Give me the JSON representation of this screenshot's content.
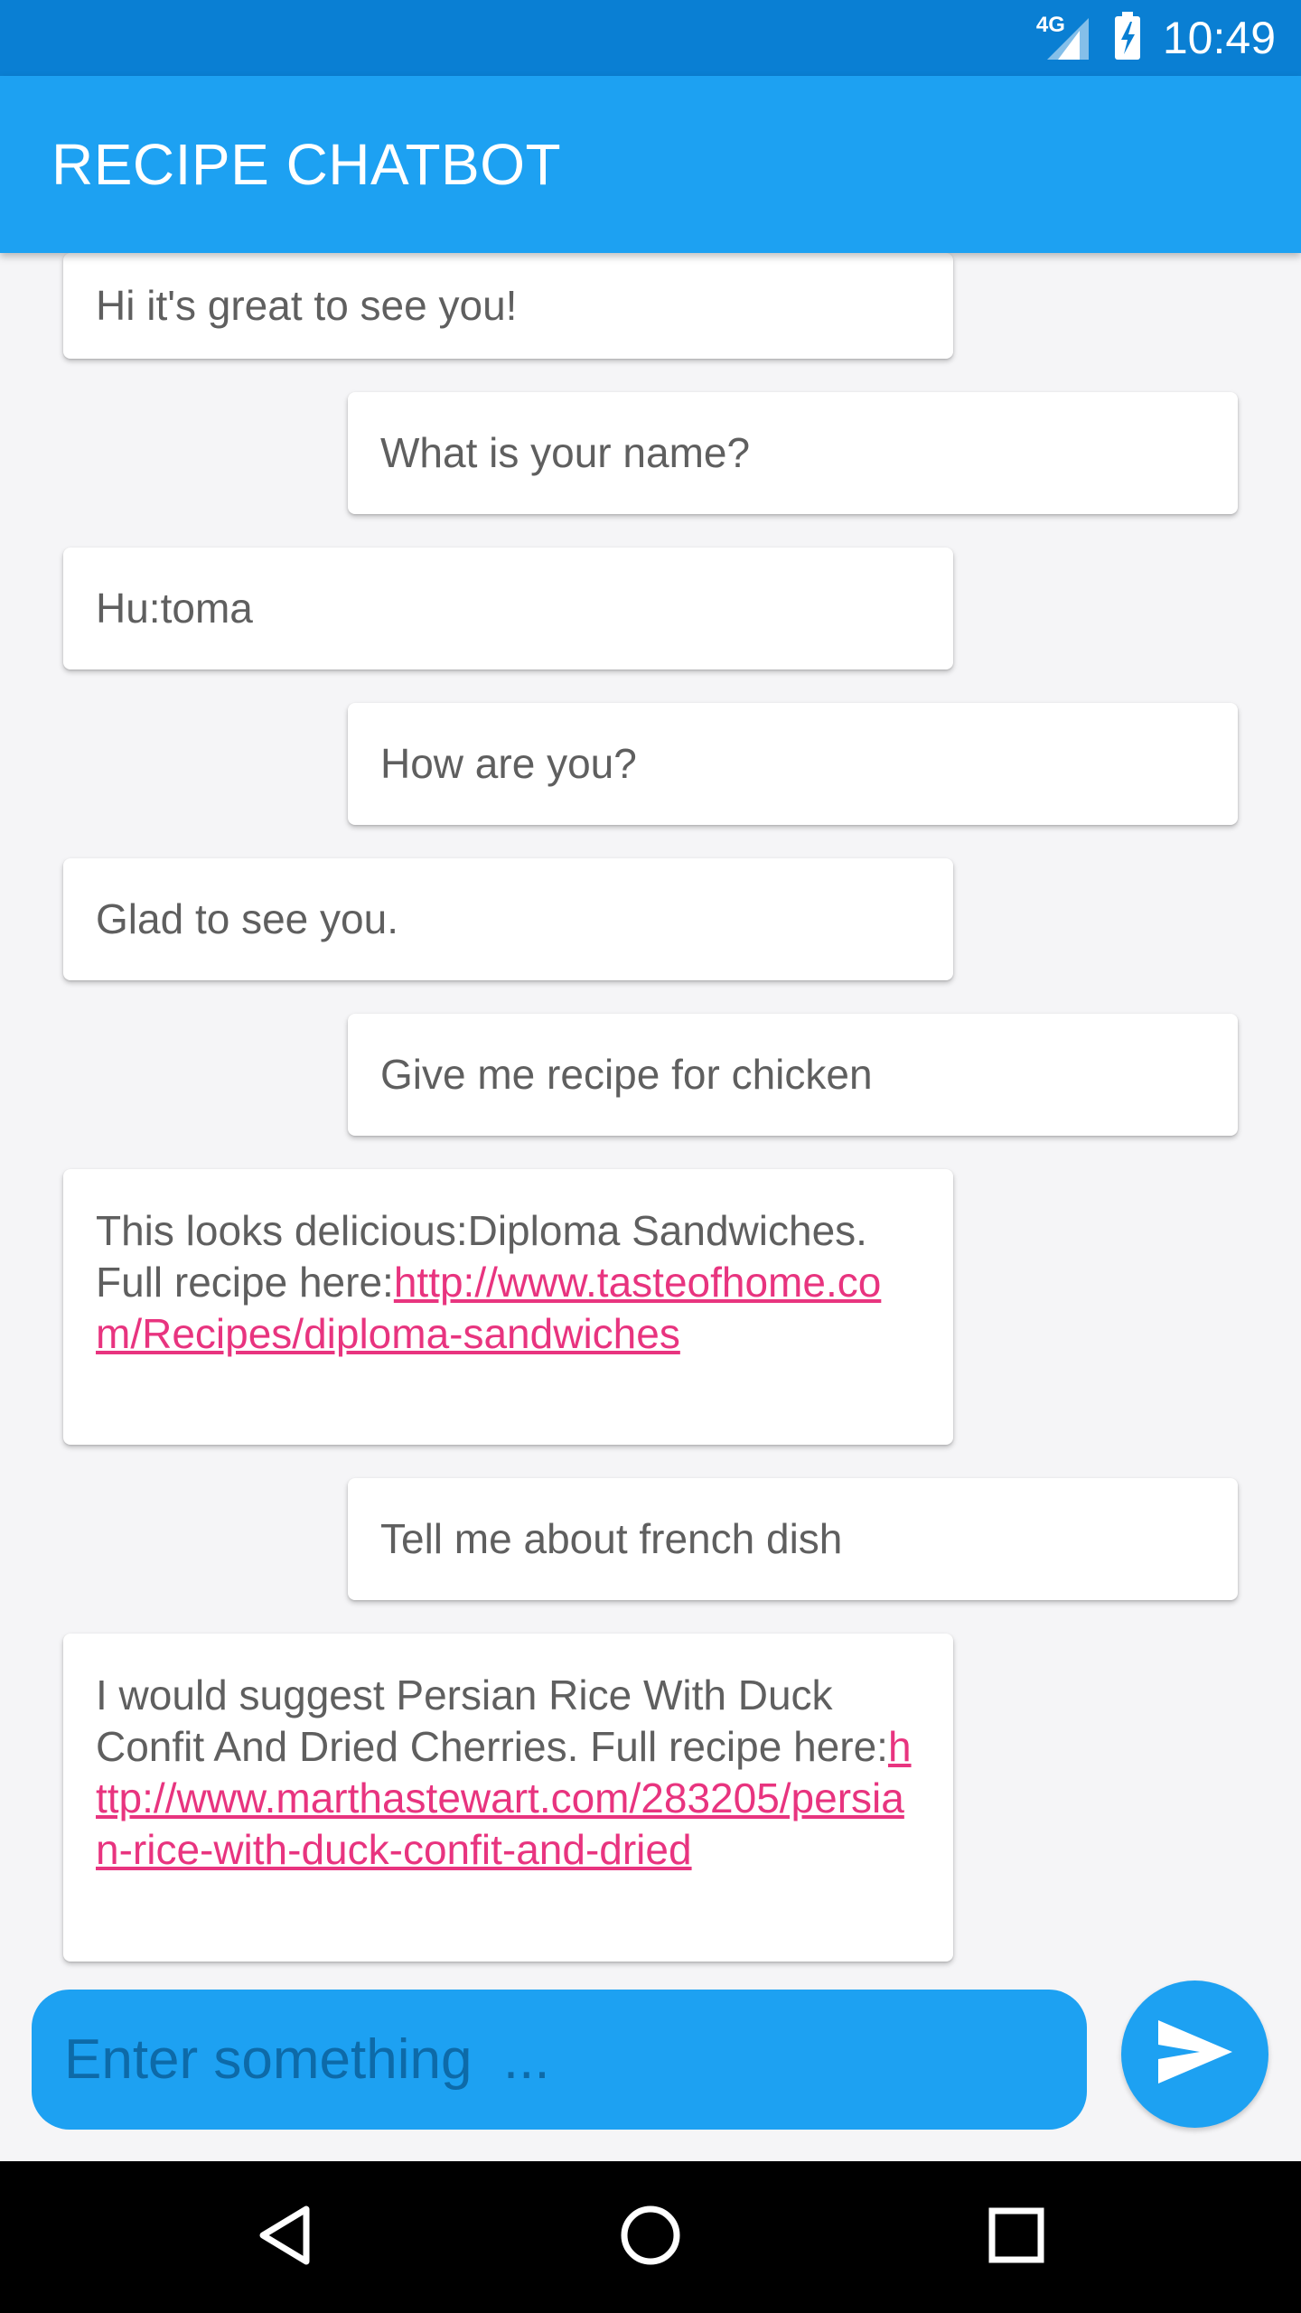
{
  "status_bar": {
    "network": "4G",
    "time": "10:49",
    "icons": [
      "signal-icon",
      "battery-charging-icon"
    ]
  },
  "app_bar": {
    "title": "RECIPE CHATBOT"
  },
  "messages": [
    {
      "sender": "bot",
      "text": "Hi it's great to see you!"
    },
    {
      "sender": "user",
      "text": "What is your name?"
    },
    {
      "sender": "bot",
      "text": "Hu:toma"
    },
    {
      "sender": "user",
      "text": "How are you?"
    },
    {
      "sender": "bot",
      "text": "Glad to see you."
    },
    {
      "sender": "user",
      "text": "Give me recipe for chicken"
    },
    {
      "sender": "bot",
      "text": "This looks delicious:Diploma Sandwiches. Full recipe here:",
      "link": "http://www.tasteofhome.com/Recipes/diploma-sandwiches"
    },
    {
      "sender": "user",
      "text": "Tell me about french dish"
    },
    {
      "sender": "bot",
      "text": "I would suggest Persian Rice With Duck Confit And Dried Cherries. Full recipe here:",
      "link": "http://www.marthastewart.com/283205/persian-rice-with-duck-confit-and-dried"
    }
  ],
  "composer": {
    "placeholder": "Enter something  ...",
    "send_icon": "send-icon"
  },
  "nav": {
    "icons": [
      "back-icon",
      "home-icon",
      "recents-icon"
    ]
  },
  "colors": {
    "status_bar": "#0a7fd3",
    "app_bar": "#1da1f2",
    "link": "#e8347f",
    "message_text": "#5f5f5f",
    "background": "#f5f5f7"
  }
}
